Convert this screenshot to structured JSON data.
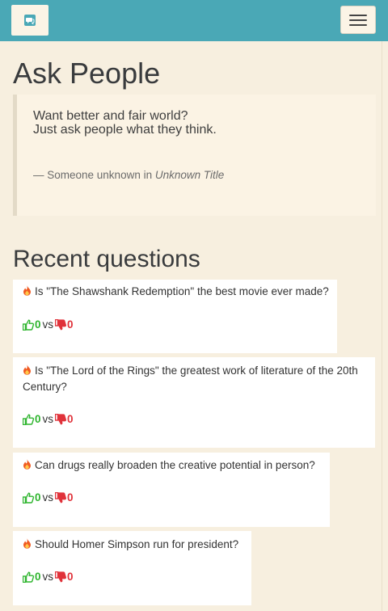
{
  "header": {
    "brand_icon": "chat-bubbles-icon",
    "menu_icon": "hamburger-icon",
    "color": "#4aa8b6"
  },
  "page": {
    "title": "Ask People"
  },
  "quote": {
    "line1": "Want better and fair world?",
    "line2": "Just ask people what they think.",
    "author_prefix": "— Someone unknown in ",
    "source": "Unknown Title"
  },
  "recent": {
    "heading": "Recent questions",
    "vs_label": "vs",
    "up_color": "#2fb52f",
    "down_color": "#e0323a",
    "items": [
      {
        "question": "Is \"The Shawshank Redemption\" the best movie ever made?",
        "up_votes": "0",
        "down_votes": "0"
      },
      {
        "question": "Is \"The Lord of the Rings\" the greatest work of literature of the 20th Century?",
        "up_votes": "0",
        "down_votes": "0"
      },
      {
        "question": "Can drugs really broaden the creative potential in person?",
        "up_votes": "0",
        "down_votes": "0"
      },
      {
        "question": "Should Homer Simpson run for president?",
        "up_votes": "0",
        "down_votes": "0"
      }
    ]
  }
}
